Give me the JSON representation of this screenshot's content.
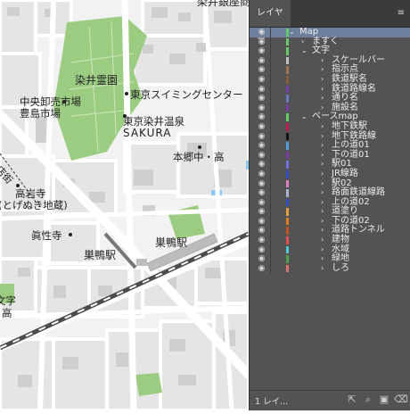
{
  "map": {
    "labels": {
      "top_cut": "染井銀座商",
      "cemetery": "染井霊園",
      "tokyo_swim": "東京スイミングセンター",
      "market_1": "中央卸売市場",
      "market_2": "豊島市場",
      "onsen_1": "東京染井温泉",
      "onsen_2": "SAKURA",
      "hongo": "本郷中・高",
      "shotengai": "商店街",
      "takaiwa_1": "高岩寺",
      "takaiwa_2": "(とげぬき地蔵)",
      "shinsho": "眞性寺",
      "sugamo_jr": "巣鴨駅",
      "sugamo_subway": "巣鴨駅",
      "left_text_1": "文字",
      "left_text_2": "高"
    },
    "colors": {
      "background": "#f2f2f2",
      "road": "#ffffff",
      "block": "#e6e6e6",
      "building": "#cfcfcf",
      "park": "#9ccc82",
      "water": "#8ec8ee",
      "rail": "#4c4c4c"
    }
  },
  "panel": {
    "tab_label": "レイヤー",
    "footer_count": "1 レイ...",
    "footer_icons": [
      "export-icon",
      "search-icon",
      "new-layer-icon",
      "delete-icon"
    ],
    "layers": [
      {
        "label": "Map",
        "color": "#66cc66",
        "level": 0,
        "expanded": true,
        "selected": true
      },
      {
        "label": "ますく",
        "color": "#66cc66",
        "level": 1,
        "expanded": false
      },
      {
        "label": "文字",
        "color": "#66cc66",
        "level": 1,
        "expanded": true
      },
      {
        "label": "スケールバー",
        "color": "#c0c0c0",
        "level": 2,
        "expanded": false
      },
      {
        "label": "指示点",
        "color": "#a07850",
        "level": 2,
        "expanded": false
      },
      {
        "label": "鉄道駅名",
        "color": "#8a5a3a",
        "level": 2,
        "expanded": false
      },
      {
        "label": "鉄道路線名",
        "color": "#7a3da8",
        "level": 2,
        "expanded": false
      },
      {
        "label": "通り名",
        "color": "#6a78c0",
        "level": 2,
        "expanded": false
      },
      {
        "label": "施設名",
        "color": "#7a3da8",
        "level": 2,
        "expanded": false
      },
      {
        "label": "ベースmap",
        "color": "#66cc66",
        "level": 1,
        "expanded": true
      },
      {
        "label": "地下鉄駅",
        "color": "#c01a50",
        "level": 2,
        "expanded": false
      },
      {
        "label": "地下鉄路線",
        "color": "#101010",
        "level": 2,
        "expanded": false
      },
      {
        "label": "上の道01",
        "color": "#4d9de0",
        "level": 2,
        "expanded": false
      },
      {
        "label": "下の道01",
        "color": "#7a3da8",
        "level": 2,
        "expanded": false
      },
      {
        "label": "駅01",
        "color": "#7070e0",
        "level": 2,
        "expanded": false
      },
      {
        "label": "JR線路",
        "color": "#3050c8",
        "level": 2,
        "expanded": false
      },
      {
        "label": "駅02",
        "color": "#e080c0",
        "level": 2,
        "expanded": false
      },
      {
        "label": "路面鉄道線路",
        "color": "#b0b0d0",
        "level": 2,
        "expanded": false
      },
      {
        "label": "上の道02",
        "color": "#3050c8",
        "level": 2,
        "expanded": false
      },
      {
        "label": "道塗り",
        "color": "#e0a040",
        "level": 2,
        "expanded": false
      },
      {
        "label": "下の道02",
        "color": "#e08020",
        "level": 2,
        "expanded": false
      },
      {
        "label": "道路トンネル",
        "color": "#c05020",
        "level": 2,
        "expanded": false
      },
      {
        "label": "建物",
        "color": "#e05050",
        "level": 2,
        "expanded": false
      },
      {
        "label": "水域",
        "color": "#50c8c8",
        "level": 2,
        "expanded": false
      },
      {
        "label": "緑地",
        "color": "#50a050",
        "level": 2,
        "expanded": false
      },
      {
        "label": "しろ",
        "color": "#e07070",
        "level": 2,
        "expanded": false
      }
    ]
  }
}
